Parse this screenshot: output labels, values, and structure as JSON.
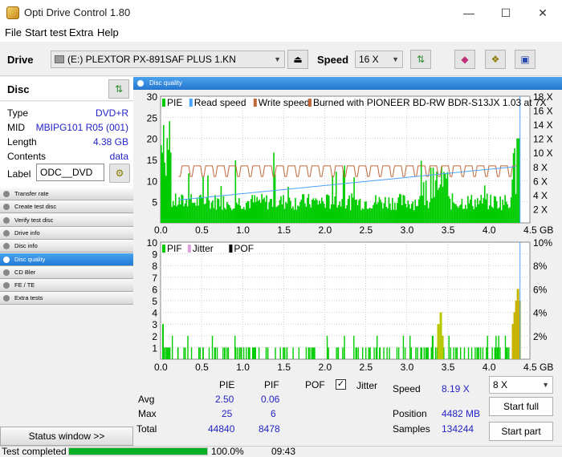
{
  "window": {
    "title": "Opti Drive Control 1.80",
    "min": "—",
    "max": "☐",
    "close": "✕"
  },
  "menu": [
    "File",
    "Start test",
    "Extra",
    "Help"
  ],
  "toolbar": {
    "drive_label": "Drive",
    "drive_value": "(E:)   PLEXTOR PX-891SAF PLUS 1.KN",
    "speed_label": "Speed",
    "speed_value": "16 X"
  },
  "disc": {
    "title": "Disc",
    "type_label": "Type",
    "type": "DVD+R",
    "mid_label": "MID",
    "mid": "MBIPG101 R05 (001)",
    "length_label": "Length",
    "length": "4.38 GB",
    "contents_label": "Contents",
    "contents": "data",
    "label_label": "Label",
    "label_value": "ODC__DVD"
  },
  "nav": [
    "Transfer rate",
    "Create test disc",
    "Verify test disc",
    "Drive info",
    "Disc info",
    "Disc quality",
    "CD Bler",
    "FE / TE",
    "Extra tests"
  ],
  "nav_selected": 5,
  "status_window": "Status window >>",
  "panel_title": "Disc quality",
  "chart_data": [
    {
      "type": "bar",
      "legend": [
        "PIE",
        "Read speed",
        "Write speed"
      ],
      "annotation": "Burned with PIONEER BD-RW   BDR-S13JX 1.03 at 7X",
      "xlim": [
        0,
        4.5
      ],
      "ylim": [
        0,
        30
      ],
      "x_ticks": [
        "0.0",
        "0.5",
        "1.0",
        "1.5",
        "2.0",
        "2.5",
        "3.0",
        "3.5",
        "4.0",
        "4.5 GB"
      ],
      "y_ticks": [
        "30",
        "25",
        "20",
        "15",
        "10",
        "5"
      ],
      "y2_ticks": [
        "18 X",
        "16 X",
        "14 X",
        "12 X",
        "10 X",
        "8 X",
        "6 X",
        "4 X",
        "2 X"
      ],
      "y2lim": [
        0,
        18
      ],
      "series": [
        {
          "name": "PIE",
          "color": "#00cc00"
        },
        {
          "name": "Read speed",
          "color": "#4aa3ff"
        },
        {
          "name": "Write speed",
          "color": "#c0683a"
        }
      ]
    },
    {
      "type": "bar",
      "legend": [
        "PIF",
        "Jitter",
        "POF"
      ],
      "xlim": [
        0,
        4.5
      ],
      "ylim": [
        0,
        10
      ],
      "x_ticks": [
        "0.0",
        "0.5",
        "1.0",
        "1.5",
        "2.0",
        "2.5",
        "3.0",
        "3.5",
        "4.0",
        "4.5 GB"
      ],
      "y_ticks": [
        "10",
        "9",
        "8",
        "7",
        "6",
        "5",
        "4",
        "3",
        "2",
        "1"
      ],
      "y2_ticks": [
        "10%",
        "8%",
        "6%",
        "4%",
        "2%"
      ],
      "series": [
        {
          "name": "PIF",
          "color": "#00cc00"
        },
        {
          "name": "Jitter",
          "color": "#d9a0d9"
        },
        {
          "name": "POF",
          "color": "#000000"
        }
      ]
    }
  ],
  "stats": {
    "col_pie": "PIE",
    "col_pif": "PIF",
    "col_pof": "POF",
    "jitter_label": "Jitter",
    "jitter_check": "✓",
    "avg_label": "Avg",
    "avg_pie": "2.50",
    "avg_pif": "0.06",
    "max_label": "Max",
    "max_pie": "25",
    "max_pif": "6",
    "total_label": "Total",
    "total_pie": "44840",
    "total_pif": "8478",
    "speed_label": "Speed",
    "speed": "8.19 X",
    "position_label": "Position",
    "position": "4482 MB",
    "samples_label": "Samples",
    "samples": "134244",
    "speed_select": "8 X",
    "start_full": "Start full",
    "start_part": "Start part"
  },
  "status": {
    "text": "Test completed",
    "progress": 100,
    "progress_text": "100.0%",
    "time": "09:43"
  },
  "colors": {
    "pie": "#00cc00",
    "read": "#4aa3ff",
    "write": "#c0683a",
    "pif_spike": "#b8c800"
  }
}
